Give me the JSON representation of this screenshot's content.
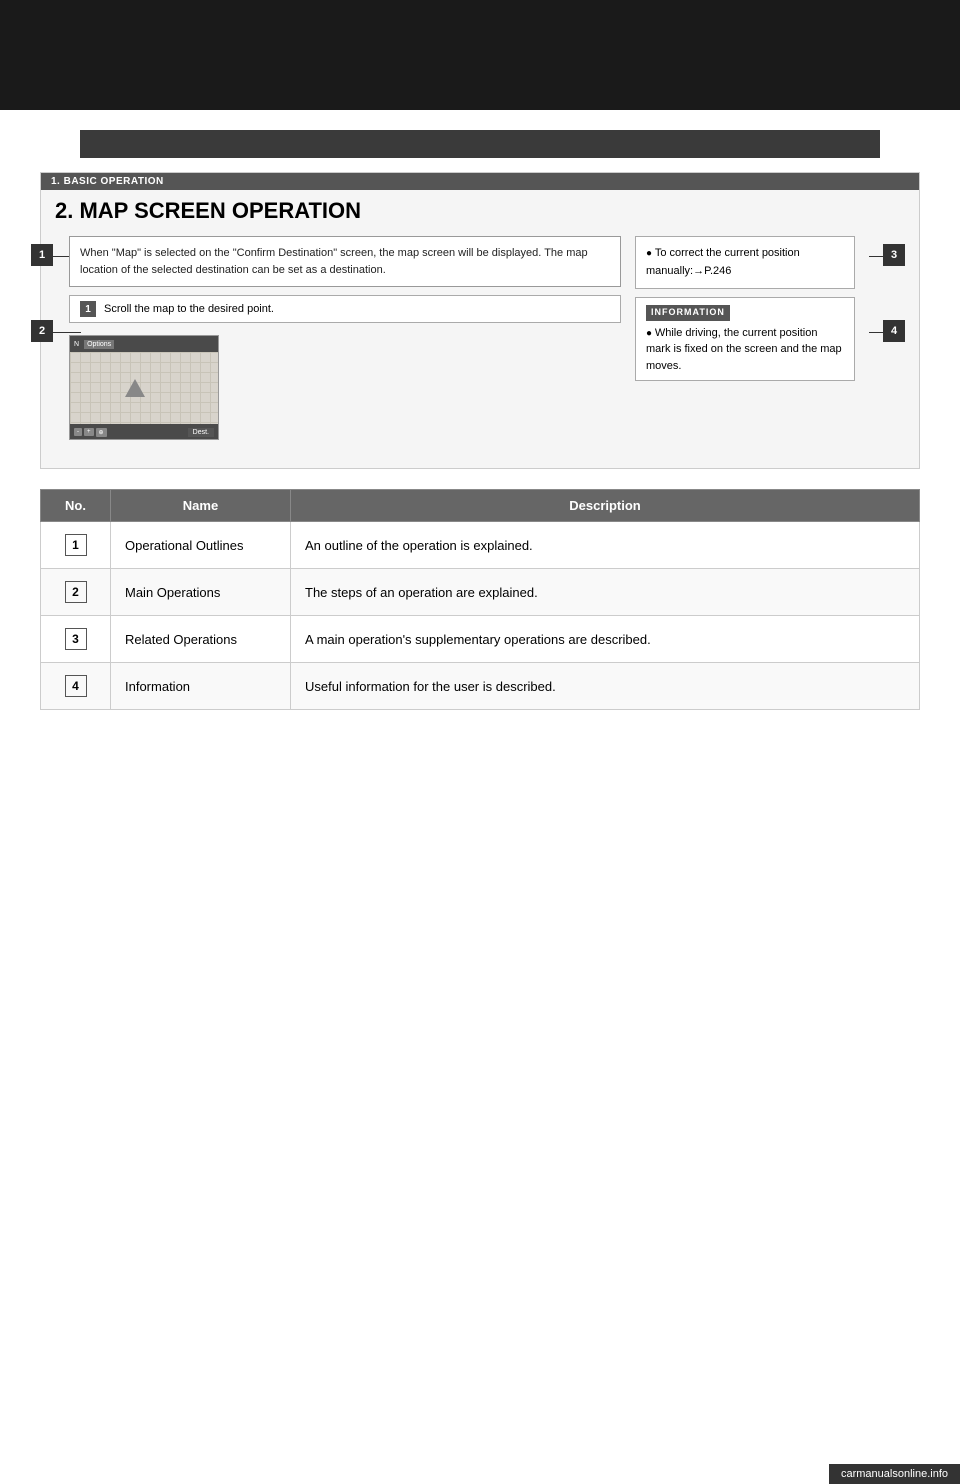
{
  "page": {
    "background": "#fff"
  },
  "section_header": {
    "text": ""
  },
  "illustration": {
    "chapter_label": "1. BASIC OPERATION",
    "title": "2. MAP SCREEN OPERATION",
    "outline_box_text": "When \"Map\" is selected on the \"Confirm Destination\" screen, the map screen will be displayed. The map location of the selected destination can be set as a destination.",
    "step_text": "Scroll the map to the desired point.",
    "related_ops_bullet": "To correct the current position manually:→P.246",
    "info_label": "INFORMATION",
    "info_bullet": "While driving, the current position mark is fixed on the screen and the map moves.",
    "callout_1": "1",
    "callout_2": "2",
    "callout_3": "3",
    "callout_4": "4"
  },
  "table": {
    "headers": [
      "No.",
      "Name",
      "Description"
    ],
    "rows": [
      {
        "no": "1",
        "name": "Operational Outlines",
        "description": "An outline of the operation is explained."
      },
      {
        "no": "2",
        "name": "Main Operations",
        "description": "The steps of an operation are explained."
      },
      {
        "no": "3",
        "name": "Related Operations",
        "description": "A main operation's supplementary operations are described."
      },
      {
        "no": "4",
        "name": "Information",
        "description": "Useful information for the user is described."
      }
    ]
  },
  "footer": {
    "url": "carmanualsonline.info"
  }
}
